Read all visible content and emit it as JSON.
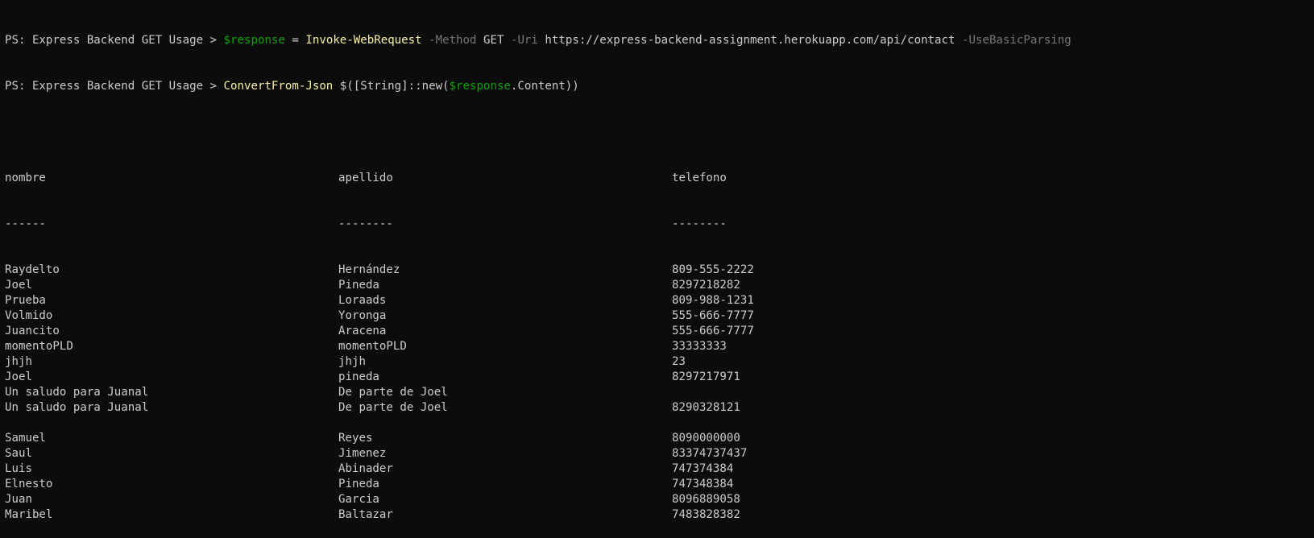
{
  "prompt": "PS: Express Backend GET Usage > ",
  "command1": {
    "var": "$response",
    "assign": " = ",
    "cmdlet": "Invoke-WebRequest",
    "param1": " -Method",
    "val1": " GET",
    "param2": " -Uri",
    "val2": " https://express-backend-assignment.herokuapp.com/api/contact",
    "param3": " -UseBasicParsing"
  },
  "command2": {
    "cmdlet": "ConvertFrom-Json",
    "arg_start": " $([String]::new(",
    "var": "$response",
    "arg_end": ".Content))"
  },
  "table": {
    "headers": [
      "nombre",
      "apellido",
      "telefono"
    ],
    "underlines": [
      "------",
      "--------",
      "--------"
    ],
    "rows": [
      [
        "Raydelto",
        "Hernández",
        "809-555-2222"
      ],
      [
        "Joel",
        "Pineda",
        "8297218282"
      ],
      [
        "Prueba",
        "Loraads",
        "809-988-1231"
      ],
      [
        "Volmido",
        "Yoronga",
        "555-666-7777"
      ],
      [
        "Juancito",
        "Aracena",
        "555-666-7777"
      ],
      [
        "momentoPLD",
        "momentoPLD",
        "33333333"
      ],
      [
        "jhjh",
        "jhjh",
        "23"
      ],
      [
        "Joel",
        "pineda",
        "8297217971"
      ],
      [
        "Un saludo para Juanal",
        "De parte de Joel",
        ""
      ],
      [
        "Un saludo para Juanal",
        "De parte de Joel",
        "8290328121"
      ],
      [
        "",
        "",
        ""
      ],
      [
        "Samuel",
        "Reyes",
        "8090000000"
      ],
      [
        "Saul",
        "Jimenez",
        "83374737437"
      ],
      [
        "Luis",
        "Abinader",
        "747374384"
      ],
      [
        "Elnesto",
        "Pineda",
        "747348384"
      ],
      [
        "Juan",
        "Garcia",
        "8096889058"
      ],
      [
        "Maribel",
        "Baltazar",
        "7483828382"
      ]
    ]
  }
}
